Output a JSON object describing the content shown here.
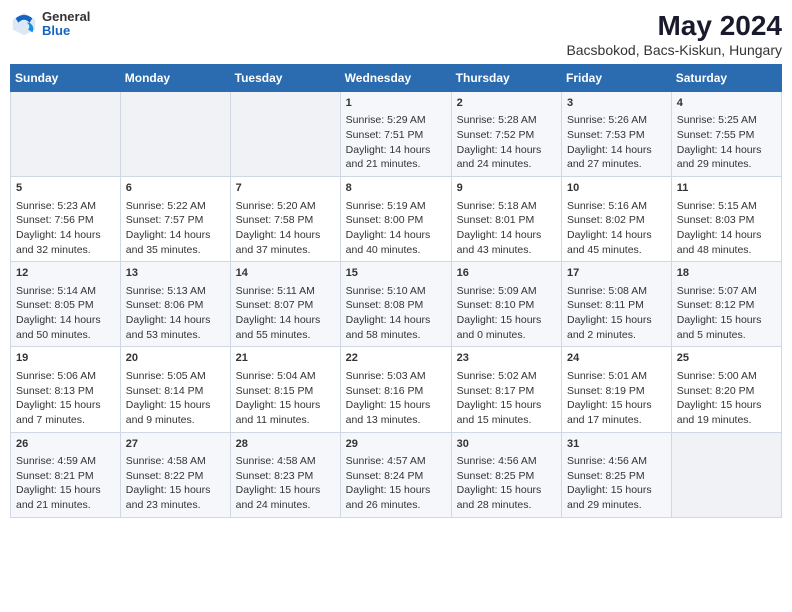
{
  "header": {
    "logo": {
      "general": "General",
      "blue": "Blue"
    },
    "title": "May 2024",
    "location": "Bacsbokod, Bacs-Kiskun, Hungary"
  },
  "days_of_week": [
    "Sunday",
    "Monday",
    "Tuesday",
    "Wednesday",
    "Thursday",
    "Friday",
    "Saturday"
  ],
  "weeks": [
    [
      {
        "day": "",
        "sunrise": "",
        "sunset": "",
        "daylight": ""
      },
      {
        "day": "",
        "sunrise": "",
        "sunset": "",
        "daylight": ""
      },
      {
        "day": "",
        "sunrise": "",
        "sunset": "",
        "daylight": ""
      },
      {
        "day": "1",
        "sunrise": "Sunrise: 5:29 AM",
        "sunset": "Sunset: 7:51 PM",
        "daylight": "Daylight: 14 hours and 21 minutes."
      },
      {
        "day": "2",
        "sunrise": "Sunrise: 5:28 AM",
        "sunset": "Sunset: 7:52 PM",
        "daylight": "Daylight: 14 hours and 24 minutes."
      },
      {
        "day": "3",
        "sunrise": "Sunrise: 5:26 AM",
        "sunset": "Sunset: 7:53 PM",
        "daylight": "Daylight: 14 hours and 27 minutes."
      },
      {
        "day": "4",
        "sunrise": "Sunrise: 5:25 AM",
        "sunset": "Sunset: 7:55 PM",
        "daylight": "Daylight: 14 hours and 29 minutes."
      }
    ],
    [
      {
        "day": "5",
        "sunrise": "Sunrise: 5:23 AM",
        "sunset": "Sunset: 7:56 PM",
        "daylight": "Daylight: 14 hours and 32 minutes."
      },
      {
        "day": "6",
        "sunrise": "Sunrise: 5:22 AM",
        "sunset": "Sunset: 7:57 PM",
        "daylight": "Daylight: 14 hours and 35 minutes."
      },
      {
        "day": "7",
        "sunrise": "Sunrise: 5:20 AM",
        "sunset": "Sunset: 7:58 PM",
        "daylight": "Daylight: 14 hours and 37 minutes."
      },
      {
        "day": "8",
        "sunrise": "Sunrise: 5:19 AM",
        "sunset": "Sunset: 8:00 PM",
        "daylight": "Daylight: 14 hours and 40 minutes."
      },
      {
        "day": "9",
        "sunrise": "Sunrise: 5:18 AM",
        "sunset": "Sunset: 8:01 PM",
        "daylight": "Daylight: 14 hours and 43 minutes."
      },
      {
        "day": "10",
        "sunrise": "Sunrise: 5:16 AM",
        "sunset": "Sunset: 8:02 PM",
        "daylight": "Daylight: 14 hours and 45 minutes."
      },
      {
        "day": "11",
        "sunrise": "Sunrise: 5:15 AM",
        "sunset": "Sunset: 8:03 PM",
        "daylight": "Daylight: 14 hours and 48 minutes."
      }
    ],
    [
      {
        "day": "12",
        "sunrise": "Sunrise: 5:14 AM",
        "sunset": "Sunset: 8:05 PM",
        "daylight": "Daylight: 14 hours and 50 minutes."
      },
      {
        "day": "13",
        "sunrise": "Sunrise: 5:13 AM",
        "sunset": "Sunset: 8:06 PM",
        "daylight": "Daylight: 14 hours and 53 minutes."
      },
      {
        "day": "14",
        "sunrise": "Sunrise: 5:11 AM",
        "sunset": "Sunset: 8:07 PM",
        "daylight": "Daylight: 14 hours and 55 minutes."
      },
      {
        "day": "15",
        "sunrise": "Sunrise: 5:10 AM",
        "sunset": "Sunset: 8:08 PM",
        "daylight": "Daylight: 14 hours and 58 minutes."
      },
      {
        "day": "16",
        "sunrise": "Sunrise: 5:09 AM",
        "sunset": "Sunset: 8:10 PM",
        "daylight": "Daylight: 15 hours and 0 minutes."
      },
      {
        "day": "17",
        "sunrise": "Sunrise: 5:08 AM",
        "sunset": "Sunset: 8:11 PM",
        "daylight": "Daylight: 15 hours and 2 minutes."
      },
      {
        "day": "18",
        "sunrise": "Sunrise: 5:07 AM",
        "sunset": "Sunset: 8:12 PM",
        "daylight": "Daylight: 15 hours and 5 minutes."
      }
    ],
    [
      {
        "day": "19",
        "sunrise": "Sunrise: 5:06 AM",
        "sunset": "Sunset: 8:13 PM",
        "daylight": "Daylight: 15 hours and 7 minutes."
      },
      {
        "day": "20",
        "sunrise": "Sunrise: 5:05 AM",
        "sunset": "Sunset: 8:14 PM",
        "daylight": "Daylight: 15 hours and 9 minutes."
      },
      {
        "day": "21",
        "sunrise": "Sunrise: 5:04 AM",
        "sunset": "Sunset: 8:15 PM",
        "daylight": "Daylight: 15 hours and 11 minutes."
      },
      {
        "day": "22",
        "sunrise": "Sunrise: 5:03 AM",
        "sunset": "Sunset: 8:16 PM",
        "daylight": "Daylight: 15 hours and 13 minutes."
      },
      {
        "day": "23",
        "sunrise": "Sunrise: 5:02 AM",
        "sunset": "Sunset: 8:17 PM",
        "daylight": "Daylight: 15 hours and 15 minutes."
      },
      {
        "day": "24",
        "sunrise": "Sunrise: 5:01 AM",
        "sunset": "Sunset: 8:19 PM",
        "daylight": "Daylight: 15 hours and 17 minutes."
      },
      {
        "day": "25",
        "sunrise": "Sunrise: 5:00 AM",
        "sunset": "Sunset: 8:20 PM",
        "daylight": "Daylight: 15 hours and 19 minutes."
      }
    ],
    [
      {
        "day": "26",
        "sunrise": "Sunrise: 4:59 AM",
        "sunset": "Sunset: 8:21 PM",
        "daylight": "Daylight: 15 hours and 21 minutes."
      },
      {
        "day": "27",
        "sunrise": "Sunrise: 4:58 AM",
        "sunset": "Sunset: 8:22 PM",
        "daylight": "Daylight: 15 hours and 23 minutes."
      },
      {
        "day": "28",
        "sunrise": "Sunrise: 4:58 AM",
        "sunset": "Sunset: 8:23 PM",
        "daylight": "Daylight: 15 hours and 24 minutes."
      },
      {
        "day": "29",
        "sunrise": "Sunrise: 4:57 AM",
        "sunset": "Sunset: 8:24 PM",
        "daylight": "Daylight: 15 hours and 26 minutes."
      },
      {
        "day": "30",
        "sunrise": "Sunrise: 4:56 AM",
        "sunset": "Sunset: 8:25 PM",
        "daylight": "Daylight: 15 hours and 28 minutes."
      },
      {
        "day": "31",
        "sunrise": "Sunrise: 4:56 AM",
        "sunset": "Sunset: 8:25 PM",
        "daylight": "Daylight: 15 hours and 29 minutes."
      },
      {
        "day": "",
        "sunrise": "",
        "sunset": "",
        "daylight": ""
      }
    ]
  ]
}
